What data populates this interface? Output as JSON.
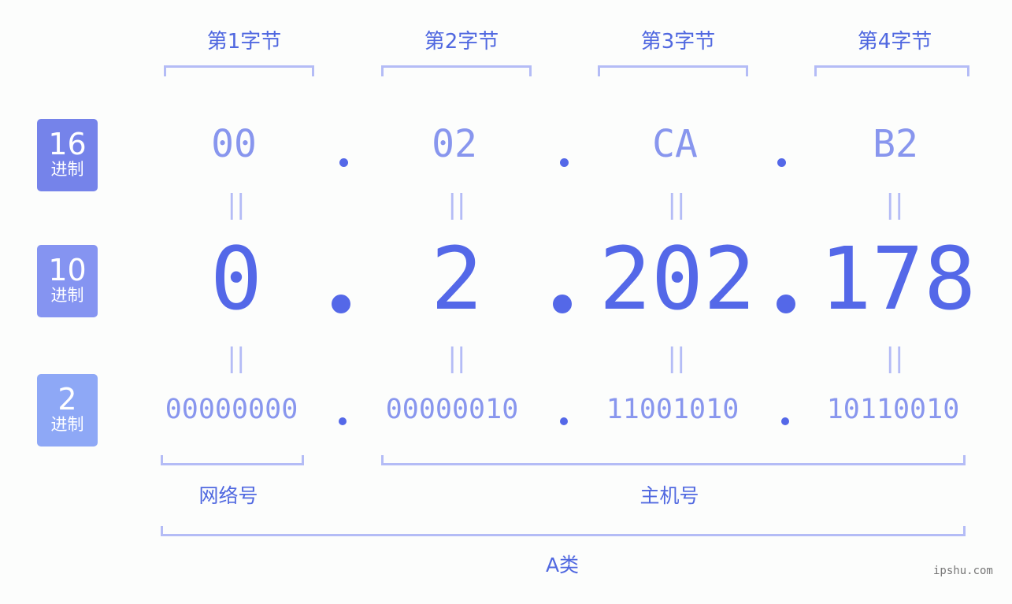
{
  "byte_titles": [
    "第1字节",
    "第2字节",
    "第3字节",
    "第4字节"
  ],
  "badges": [
    {
      "num": "16",
      "label": "进制",
      "color": "#7583ea"
    },
    {
      "num": "10",
      "label": "进制",
      "color": "#8594f1"
    },
    {
      "num": "2",
      "label": "进制",
      "color": "#8ea8f6"
    }
  ],
  "hex": [
    "00",
    "02",
    "CA",
    "B2"
  ],
  "decimal": [
    "0",
    "2",
    "202",
    "178"
  ],
  "binary": [
    "00000000",
    "00000010",
    "11001010",
    "10110010"
  ],
  "equals_sign": "||",
  "network_label": "网络号",
  "host_label": "主机号",
  "class_label": "A类",
  "watermark": "ipshu.com"
}
